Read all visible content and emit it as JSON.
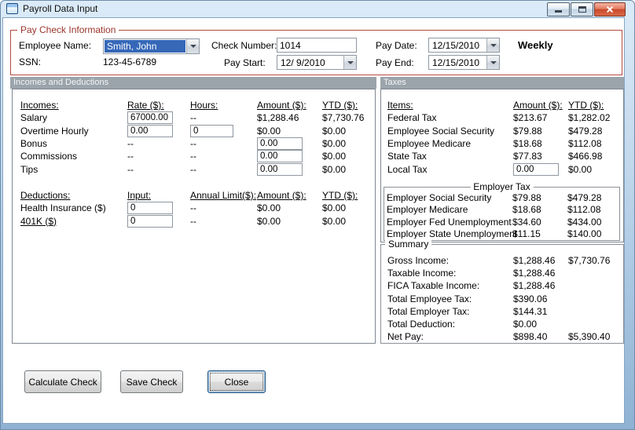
{
  "window": {
    "title": "Payroll Data Input"
  },
  "paycheck": {
    "group_title": "Pay Check Information",
    "employee_name": {
      "label": "Employee Name:",
      "value": "Smith, John"
    },
    "ssn": {
      "label": "SSN:",
      "value": "123-45-6789"
    },
    "check_number": {
      "label": "Check Number:",
      "value": "1014"
    },
    "pay_start": {
      "label": "Pay Start:",
      "value": "12/ 9/2010"
    },
    "pay_date": {
      "label": "Pay Date:",
      "value": "12/15/2010"
    },
    "pay_end": {
      "label": "Pay End:",
      "value": "12/15/2010"
    },
    "frequency": "Weekly"
  },
  "sections": {
    "incomes_header": "Incomes and Deductions",
    "taxes_header": "Taxes"
  },
  "incomes": {
    "headers": {
      "item": "Incomes:",
      "rate": "Rate ($):",
      "hours": "Hours:",
      "amount": "Amount ($):",
      "ytd": "YTD ($):"
    },
    "rows": [
      {
        "label": "Salary",
        "rate": "67000.00",
        "hours": "--",
        "amount": "$1,288.46",
        "ytd": "$7,730.76"
      },
      {
        "label": "Overtime Hourly",
        "rate": "0.00",
        "hours": "0",
        "amount": "$0.00",
        "ytd": "$0.00"
      },
      {
        "label": "Bonus",
        "rate": "--",
        "hours": "--",
        "amount": "0.00",
        "ytd": "$0.00"
      },
      {
        "label": "Commissions",
        "rate": "--",
        "hours": "--",
        "amount": "0.00",
        "ytd": "$0.00"
      },
      {
        "label": "Tips",
        "rate": "--",
        "hours": "--",
        "amount": "0.00",
        "ytd": "$0.00"
      }
    ]
  },
  "deductions": {
    "headers": {
      "item": "Deductions:",
      "input": "Input:",
      "annual_limit": "Annual Limit($):",
      "amount": "Amount ($):",
      "ytd": "YTD ($):"
    },
    "rows": [
      {
        "label": "Health Insurance ($)",
        "input": "0",
        "annual_limit": "--",
        "amount": "$0.00",
        "ytd": "$0.00"
      },
      {
        "label": "401K ($)",
        "input": "0",
        "annual_limit": "--",
        "amount": "$0.00",
        "ytd": "$0.00"
      }
    ]
  },
  "taxes": {
    "headers": {
      "item": "Items:",
      "amount": "Amount ($):",
      "ytd": "YTD ($):"
    },
    "rows": [
      {
        "label": "Federal Tax",
        "amount": "$213.67",
        "ytd": "$1,282.02"
      },
      {
        "label": "Employee Social Security",
        "amount": "$79.88",
        "ytd": "$479.28"
      },
      {
        "label": "Employee Medicare",
        "amount": "$18.68",
        "ytd": "$112.08"
      },
      {
        "label": "State Tax",
        "amount": "$77.83",
        "ytd": "$466.98"
      },
      {
        "label": "Local Tax",
        "amount": "0.00",
        "ytd": "$0.00"
      }
    ],
    "employer_group_title": "Employer Tax",
    "employer_rows": [
      {
        "label": "Employer Social Security",
        "amount": "$79.88",
        "ytd": "$479.28"
      },
      {
        "label": "Employer Medicare",
        "amount": "$18.68",
        "ytd": "$112.08"
      },
      {
        "label": "Employer Fed Unemployment",
        "amount": "$34.60",
        "ytd": "$434.00"
      },
      {
        "label": "Employer State Unemployment",
        "amount": "$11.15",
        "ytd": "$140.00"
      }
    ]
  },
  "summary": {
    "group_title": "Summary",
    "rows": [
      {
        "label": "Gross Income:",
        "amount": "$1,288.46",
        "ytd": "$7,730.76"
      },
      {
        "label": "Taxable Income:",
        "amount": "$1,288.46",
        "ytd": ""
      },
      {
        "label": "FICA Taxable Income:",
        "amount": "$1,288.46",
        "ytd": ""
      },
      {
        "label": "Total Employee Tax:",
        "amount": "$390.06",
        "ytd": ""
      },
      {
        "label": "Total Employer Tax:",
        "amount": "$144.31",
        "ytd": ""
      },
      {
        "label": "Total Deduction:",
        "amount": "$0.00",
        "ytd": ""
      },
      {
        "label": "Net Pay:",
        "amount": "$898.40",
        "ytd": "$5,390.40"
      }
    ]
  },
  "buttons": {
    "calculate": "Calculate Check",
    "save": "Save Check",
    "close": "Close"
  }
}
